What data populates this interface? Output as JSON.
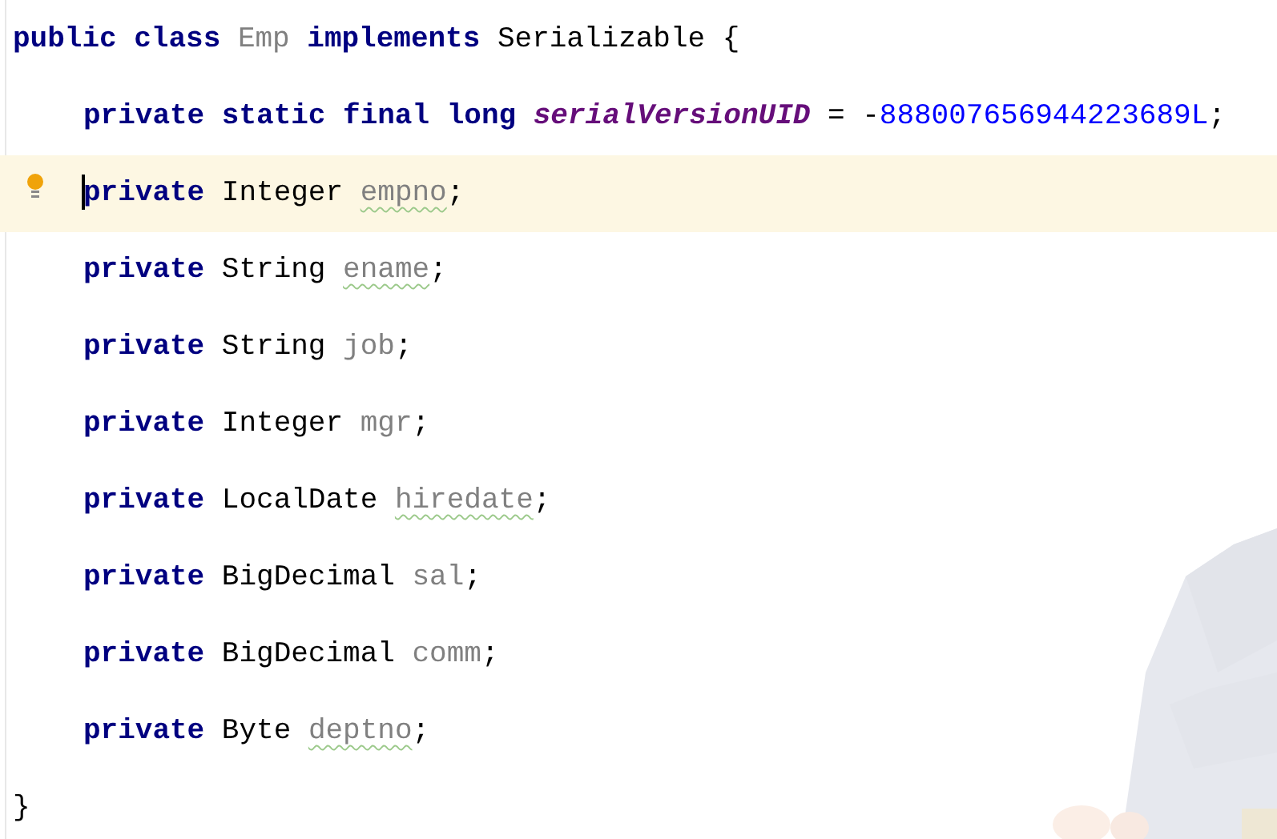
{
  "class_decl": {
    "header": [
      {
        "text": "public class ",
        "kind": "keyword"
      },
      {
        "text": "Emp",
        "kind": "unused"
      },
      {
        "text": " implements ",
        "kind": "keyword"
      },
      {
        "text": "Serializable {",
        "kind": "plain"
      }
    ],
    "members": [
      {
        "current": false,
        "bulb": false,
        "tokens": [
          {
            "text": "private static final long ",
            "kind": "keyword"
          },
          {
            "text": "serialVersionUID",
            "kind": "static_field"
          },
          {
            "text": " = -",
            "kind": "plain"
          },
          {
            "text": "888007656944223689L",
            "kind": "number"
          },
          {
            "text": ";",
            "kind": "plain"
          }
        ]
      },
      {
        "current": true,
        "bulb": true,
        "tokens": [
          {
            "text": "private",
            "kind": "keyword"
          },
          {
            "text": " Integer ",
            "kind": "plain"
          },
          {
            "text": "empno",
            "kind": "unused",
            "warning": true
          },
          {
            "text": ";",
            "kind": "plain"
          }
        ]
      },
      {
        "current": false,
        "bulb": false,
        "tokens": [
          {
            "text": "private",
            "kind": "keyword"
          },
          {
            "text": " String ",
            "kind": "plain"
          },
          {
            "text": "ename",
            "kind": "unused",
            "warning": true
          },
          {
            "text": ";",
            "kind": "plain"
          }
        ]
      },
      {
        "current": false,
        "bulb": false,
        "tokens": [
          {
            "text": "private",
            "kind": "keyword"
          },
          {
            "text": " String ",
            "kind": "plain"
          },
          {
            "text": "job",
            "kind": "unused",
            "warning": false
          },
          {
            "text": ";",
            "kind": "plain"
          }
        ]
      },
      {
        "current": false,
        "bulb": false,
        "tokens": [
          {
            "text": "private",
            "kind": "keyword"
          },
          {
            "text": " Integer ",
            "kind": "plain"
          },
          {
            "text": "mgr",
            "kind": "unused",
            "warning": false
          },
          {
            "text": ";",
            "kind": "plain"
          }
        ]
      },
      {
        "current": false,
        "bulb": false,
        "tokens": [
          {
            "text": "private",
            "kind": "keyword"
          },
          {
            "text": " LocalDate ",
            "kind": "plain"
          },
          {
            "text": "hiredate",
            "kind": "unused",
            "warning": true
          },
          {
            "text": ";",
            "kind": "plain"
          }
        ]
      },
      {
        "current": false,
        "bulb": false,
        "tokens": [
          {
            "text": "private",
            "kind": "keyword"
          },
          {
            "text": " BigDecimal ",
            "kind": "plain"
          },
          {
            "text": "sal",
            "kind": "unused",
            "warning": false
          },
          {
            "text": ";",
            "kind": "plain"
          }
        ]
      },
      {
        "current": false,
        "bulb": false,
        "tokens": [
          {
            "text": "private",
            "kind": "keyword"
          },
          {
            "text": " BigDecimal ",
            "kind": "plain"
          },
          {
            "text": "comm",
            "kind": "unused",
            "warning": false
          },
          {
            "text": ";",
            "kind": "plain"
          }
        ]
      },
      {
        "current": false,
        "bulb": false,
        "tokens": [
          {
            "text": "private",
            "kind": "keyword"
          },
          {
            "text": " Byte ",
            "kind": "plain"
          },
          {
            "text": "deptno",
            "kind": "unused",
            "warning": true
          },
          {
            "text": ";",
            "kind": "plain"
          }
        ]
      }
    ],
    "closing": "}"
  }
}
